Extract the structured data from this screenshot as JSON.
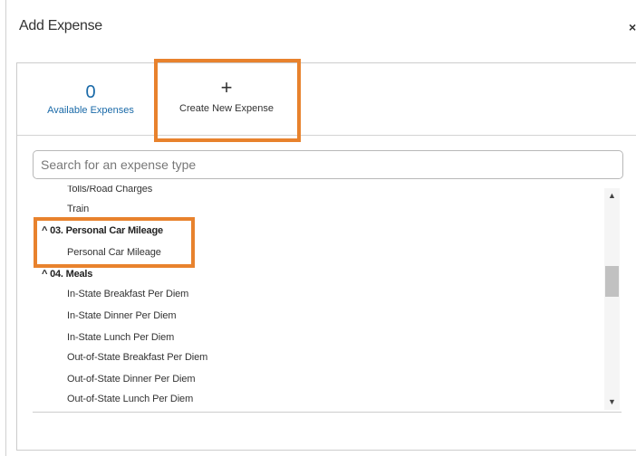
{
  "dialog": {
    "title": "Add Expense",
    "close_label": "×"
  },
  "tabs": {
    "available": {
      "count": "0",
      "label": "Available Expenses"
    },
    "create": {
      "icon": "+",
      "label": "Create New Expense"
    }
  },
  "search": {
    "placeholder": "Search for an expense type",
    "value": ""
  },
  "list": {
    "items": [
      {
        "type": "item",
        "label": "Tolls/Road Charges"
      },
      {
        "type": "item",
        "label": "Train"
      },
      {
        "type": "group",
        "label": "^ 03. Personal Car Mileage"
      },
      {
        "type": "item",
        "label": "Personal Car Mileage"
      },
      {
        "type": "group",
        "label": "^ 04. Meals"
      },
      {
        "type": "item",
        "label": "In-State Breakfast Per Diem"
      },
      {
        "type": "item",
        "label": "In-State Dinner Per Diem"
      },
      {
        "type": "item",
        "label": "In-State Lunch Per Diem"
      },
      {
        "type": "item",
        "label": "Out-of-State Breakfast Per Diem"
      },
      {
        "type": "item",
        "label": "Out-of-State Dinner Per Diem"
      },
      {
        "type": "item",
        "label": "Out-of-State Lunch Per Diem"
      }
    ]
  },
  "scrollbar": {
    "up_icon": "▲",
    "down_icon": "▼"
  },
  "colors": {
    "highlight": "#e8822d",
    "link": "#1a6aa8"
  }
}
